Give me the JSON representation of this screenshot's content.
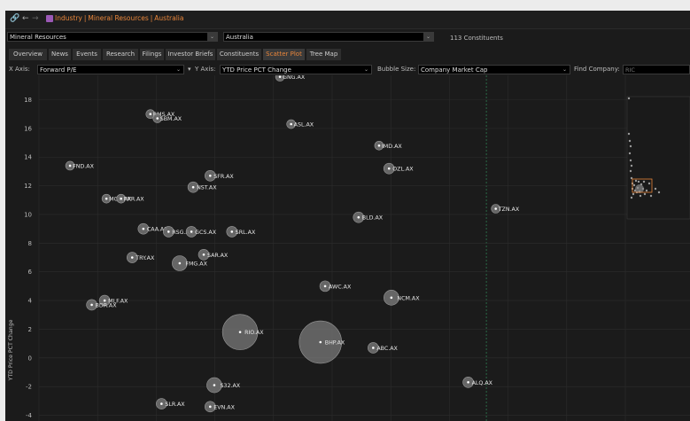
{
  "toolbar": {
    "link_icon": "link-icon",
    "back_icon": "back-arrow-icon",
    "forward_icon": "forward-arrow-icon",
    "breadcrumb": [
      "Industry",
      "Mineral Resources",
      "Australia"
    ]
  },
  "filters": {
    "industry": "Mineral Resources",
    "country": "Australia",
    "constituents": "113 Constituents"
  },
  "tabs": [
    "Overview",
    "News",
    "Events",
    "Research",
    "Filings",
    "Investor Briefs",
    "Constituents",
    "Scatter Plot",
    "Tree Map"
  ],
  "active_tab": "Scatter Plot",
  "controls": {
    "x_axis_label": "X Axis:",
    "x_axis_value": "Forward P/E",
    "y_axis_label": "Y Axis:",
    "y_axis_value": "YTD Price PCT Change",
    "bubble_label": "Bubble Size:",
    "bubble_value": "Company Market Cap",
    "find_label": "Find Company:",
    "find_placeholder": "RIC"
  },
  "colors": {
    "accent": "#e8853a",
    "background": "#1b1b1b",
    "bubble": "#8a8a8a",
    "grid": "#2c2c2c",
    "divider": "#2e7d52"
  },
  "chart_data": {
    "type": "scatter",
    "ylabel": "YTD Price PCT Change",
    "xlabel": "",
    "ylim": [
      -4.4,
      19.7
    ],
    "xlim": [
      0,
      100
    ],
    "yticks": [
      -4,
      -2,
      0,
      2,
      4,
      6,
      8,
      10,
      12,
      14,
      16,
      18
    ],
    "grid": true,
    "points": [
      {
        "label": "GNG.AX",
        "x": 41.1,
        "y": 19.6,
        "size": 1
      },
      {
        "label": "RMS.AX",
        "x": 19.0,
        "y": 17.0,
        "size": 1
      },
      {
        "label": "SBM.AX",
        "x": 20.2,
        "y": 16.7,
        "size": 1
      },
      {
        "label": "ASL.AX",
        "x": 43.0,
        "y": 16.3,
        "size": 1
      },
      {
        "label": "IMD.AX",
        "x": 58.0,
        "y": 14.8,
        "size": 1
      },
      {
        "label": "FND.AX",
        "x": 5.3,
        "y": 13.4,
        "size": 1
      },
      {
        "label": "OZL.AX",
        "x": 59.7,
        "y": 13.2,
        "size": 1.5
      },
      {
        "label": "SFR.AX",
        "x": 29.2,
        "y": 12.7,
        "size": 1.5
      },
      {
        "label": "NST.AX",
        "x": 26.3,
        "y": 11.9,
        "size": 1.5
      },
      {
        "label": "MGX.AX",
        "x": 11.5,
        "y": 11.1,
        "size": 1
      },
      {
        "label": "PRR.AX",
        "x": 14.0,
        "y": 11.1,
        "size": 1
      },
      {
        "label": "TZN.AX",
        "x": 77.9,
        "y": 10.4,
        "size": 1
      },
      {
        "label": "BLD.AX",
        "x": 54.5,
        "y": 9.8,
        "size": 1.5
      },
      {
        "label": "CAA.AX",
        "x": 17.8,
        "y": 9.0,
        "size": 1.5
      },
      {
        "label": "RSG.AX",
        "x": 22.1,
        "y": 8.8,
        "size": 1.5
      },
      {
        "label": "GCS.AX",
        "x": 26.0,
        "y": 8.8,
        "size": 1.5
      },
      {
        "label": "SRL.AX",
        "x": 32.9,
        "y": 8.8,
        "size": 1.5
      },
      {
        "label": "TRY.AX",
        "x": 15.9,
        "y": 7.0,
        "size": 1.5
      },
      {
        "label": "SAR.AX",
        "x": 28.1,
        "y": 7.2,
        "size": 1.5
      },
      {
        "label": "FMG.AX",
        "x": 24.0,
        "y": 6.6,
        "size": 3
      },
      {
        "label": "AWC.AX",
        "x": 48.8,
        "y": 5.0,
        "size": 1.5
      },
      {
        "label": "NCM.AX",
        "x": 60.1,
        "y": 4.2,
        "size": 3
      },
      {
        "label": "MLF.AX",
        "x": 11.2,
        "y": 4.0,
        "size": 1.5
      },
      {
        "label": "BDR.AX",
        "x": 9.0,
        "y": 3.7,
        "size": 1.5
      },
      {
        "label": "RIO.AX",
        "x": 34.3,
        "y": 1.8,
        "size": 15
      },
      {
        "label": "BHP.AX",
        "x": 48.0,
        "y": 1.1,
        "size": 18
      },
      {
        "label": "ABC.AX",
        "x": 57.0,
        "y": 0.7,
        "size": 1.5
      },
      {
        "label": "S32.AX",
        "x": 29.9,
        "y": -1.9,
        "size": 3
      },
      {
        "label": "ALQ.AX",
        "x": 73.2,
        "y": -1.7,
        "size": 1.5
      },
      {
        "label": "SLR.AX",
        "x": 20.9,
        "y": -3.2,
        "size": 1.5
      },
      {
        "label": "EVN.AX",
        "x": 29.2,
        "y": -3.4,
        "size": 1.5
      },
      {
        "label": "",
        "x": 10.3,
        "y": 20.3,
        "size": 1.5
      }
    ]
  }
}
